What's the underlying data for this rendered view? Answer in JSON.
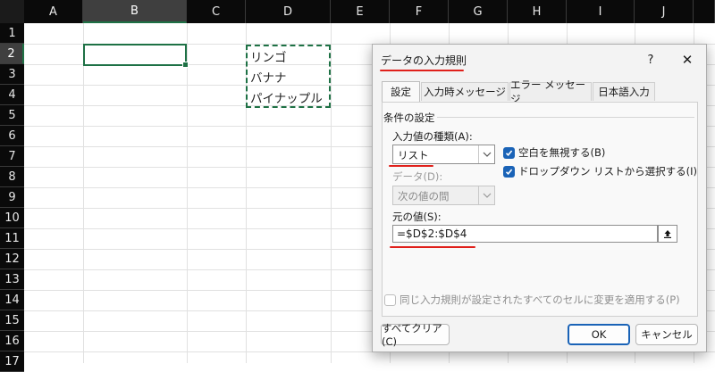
{
  "sheet": {
    "columns": [
      "A",
      "B",
      "C",
      "D",
      "E",
      "F",
      "G",
      "H",
      "I",
      "J"
    ],
    "rows": [
      "1",
      "2",
      "3",
      "4",
      "5",
      "6",
      "7",
      "8",
      "9",
      "10",
      "11",
      "12",
      "13",
      "14",
      "15",
      "16",
      "17"
    ],
    "cells": {
      "d2": "リンゴ",
      "d3": "バナナ",
      "d4": "パイナップル"
    }
  },
  "dialog": {
    "title": "データの入力規則",
    "help": "?",
    "close": "✕",
    "tabs": [
      "設定",
      "入力時メッセージ",
      "エラー メッセージ",
      "日本語入力"
    ],
    "group_label": "条件の設定",
    "type_label": "入力値の種類(A):",
    "type_value": "リスト",
    "ignore_blank": "空白を無視する(B)",
    "dropdown": "ドロップダウン リストから選択する(I)",
    "data_label": "データ(D):",
    "data_value": "次の値の間",
    "source_label": "元の値(S):",
    "source_value": "=$D$2:$D$4",
    "apply_all": "同じ入力規則が設定されたすべてのセルに変更を適用する(P)",
    "clear_all": "すべてクリア(C)",
    "ok": "OK",
    "cancel": "キャンセル"
  },
  "colors": {
    "accent": "#1e7145",
    "highlight": "#e0201b",
    "checkbox": "#1a63b7"
  }
}
